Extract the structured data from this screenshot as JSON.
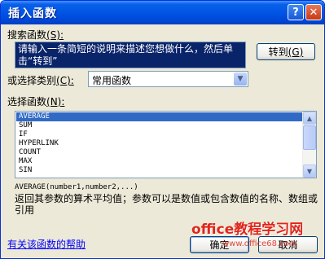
{
  "window": {
    "title": "插入函数",
    "help_glyph": "?",
    "close_glyph": "✕"
  },
  "search": {
    "label": "搜索函数",
    "accel": "(S):",
    "value": "请输入一条简短的说明来描述您想做什么，然后单击“转到”",
    "goto_label": "转到",
    "goto_accel": "(G)"
  },
  "category": {
    "label": "或选择类别",
    "accel": "(C):",
    "value": "常用函数"
  },
  "function_list": {
    "label": "选择函数",
    "accel": "(N):",
    "items": [
      "AVERAGE",
      "SUM",
      "IF",
      "HYPERLINK",
      "COUNT",
      "MAX",
      "SIN"
    ],
    "selected_index": 0
  },
  "details": {
    "syntax": "AVERAGE(number1,number2,...)",
    "description": "返回其参数的算术平均值；参数可以是数值或包含数值的名称、数组或引用"
  },
  "footer": {
    "help_link": "有关该函数的帮助",
    "ok_label": "确定",
    "cancel_label": "取消"
  },
  "watermark": {
    "line1": "office教程学习网",
    "line2": "www.office68.com"
  }
}
